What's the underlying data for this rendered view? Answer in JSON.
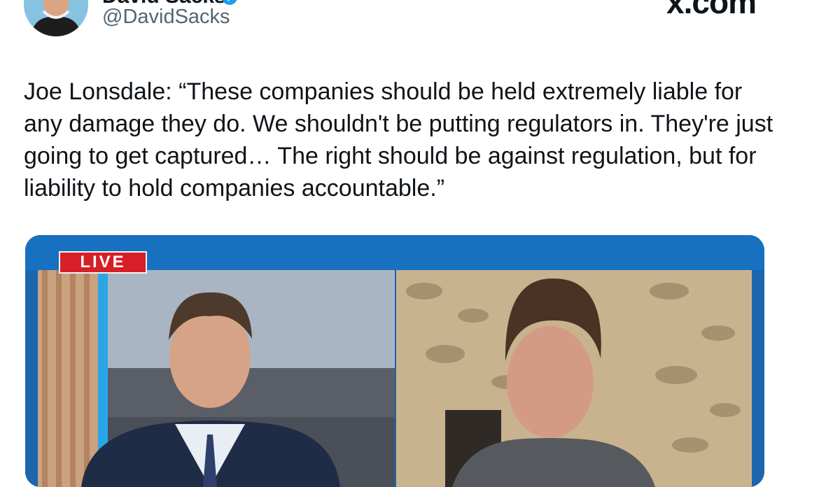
{
  "author": {
    "display_name": "David Sacks",
    "handle": "@DavidSacks",
    "verified": true
  },
  "brand": "x.com",
  "tweet": {
    "text": "Joe Lonsdale: “These companies should be held extremely liable for any damage they do. We shouldn't be putting regulators in. They're just going to get captured… The right should be against regulation, but for liability to hold companies accountable.”"
  },
  "media": {
    "badge": "LIVE"
  },
  "colors": {
    "text_primary": "#0f1419",
    "text_secondary": "#536471",
    "verified_blue": "#1d9bf0",
    "live_red": "#d61f26",
    "frame_blue": "#1f6fb5"
  },
  "icons": [
    "verified-badge-icon"
  ]
}
